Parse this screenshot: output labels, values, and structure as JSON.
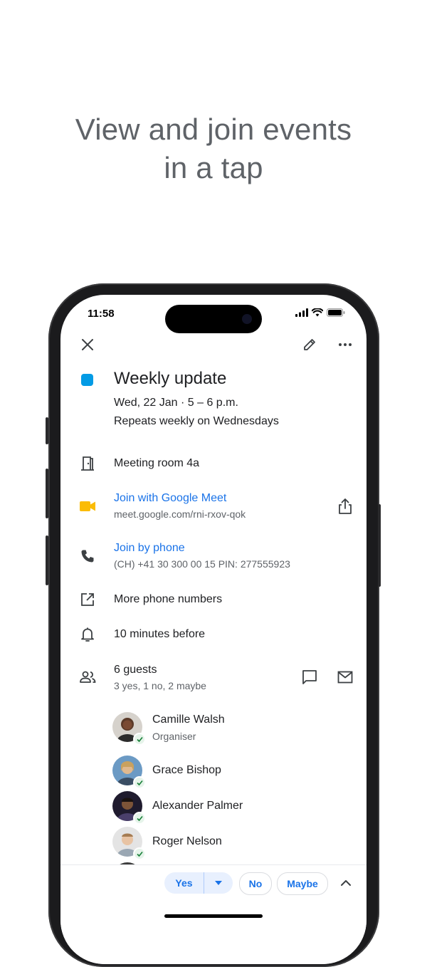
{
  "headline": {
    "line1": "View and join events",
    "line2": "in a tap"
  },
  "status_bar": {
    "time": "11:58"
  },
  "toolbar": {
    "close_icon": "close-icon",
    "edit_icon": "pencil-icon",
    "more_icon": "more-horizontal-icon"
  },
  "event": {
    "color": "#039be5",
    "title": "Weekly update",
    "datetime": "Wed, 22 Jan · 5 – 6 p.m.",
    "recurrence": "Repeats weekly on Wednesdays",
    "location": "Meeting room 4a",
    "meet_label": "Join with Google Meet",
    "meet_url": "meet.google.com/rni-rxov-qok",
    "phone_label": "Join by phone",
    "phone_detail": "(CH) +41 30 300 00 15 PIN: 277555923",
    "more_numbers": "More phone numbers",
    "reminder": "10 minutes before",
    "guests_count": "6 guests",
    "guests_summary": "3 yes, 1 no, 2 maybe"
  },
  "guests": [
    {
      "name": "Camille Walsh",
      "role": "Organiser"
    },
    {
      "name": "Grace Bishop",
      "role": ""
    },
    {
      "name": "Alexander Palmer",
      "role": ""
    },
    {
      "name": "Roger Nelson",
      "role": ""
    }
  ],
  "rsvp": {
    "yes": "Yes",
    "no": "No",
    "maybe": "Maybe"
  },
  "colors": {
    "accent": "#1a73e8",
    "meet_yellow": "#fbbc04",
    "yes_bg": "#e8f0fe"
  }
}
